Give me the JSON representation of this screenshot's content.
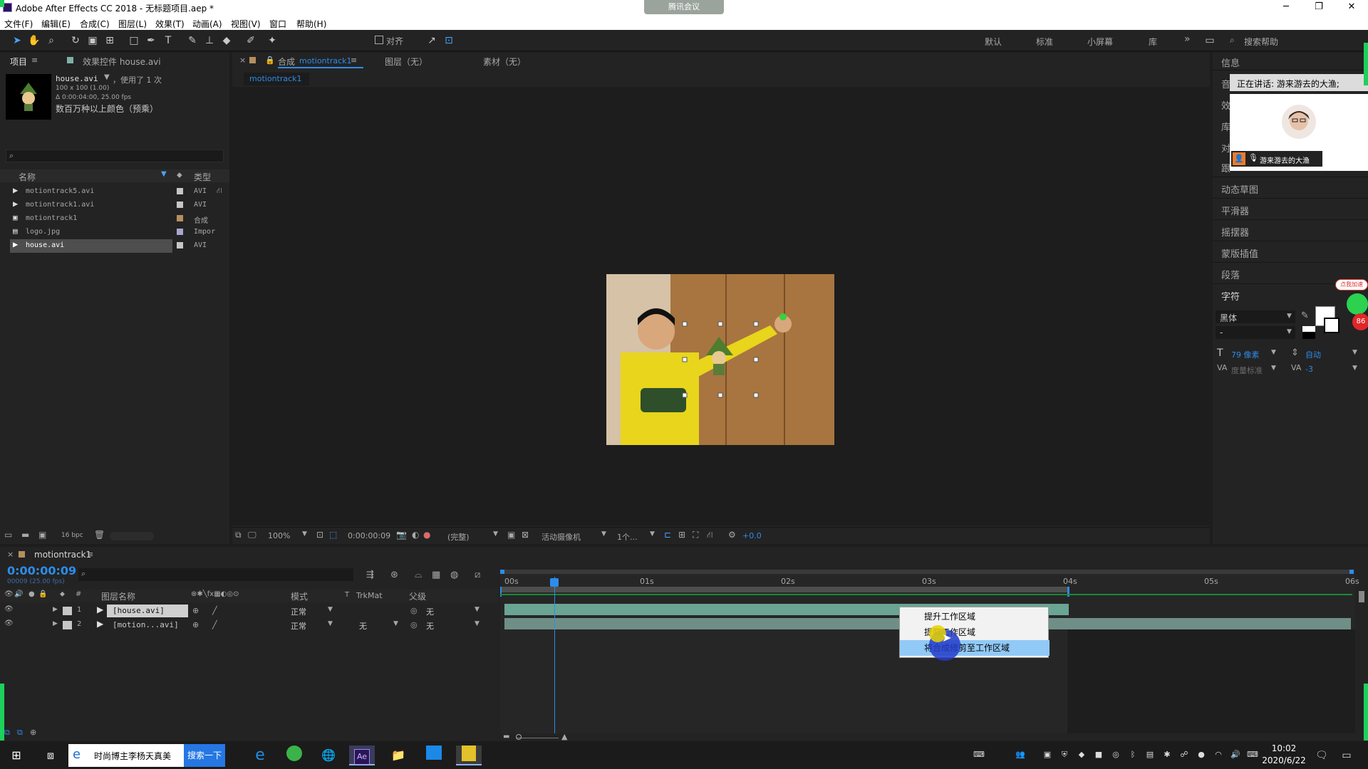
{
  "window": {
    "title": "Adobe After Effects CC 2018 - 无标题项目.aep *"
  },
  "meeting_badge": "腾讯会议",
  "menu": [
    "文件(F)",
    "编辑(E)",
    "合成(C)",
    "图层(L)",
    "效果(T)",
    "动画(A)",
    "视图(V)",
    "窗口",
    "帮助(H)"
  ],
  "toolbar": {
    "align_label": "对齐",
    "workspaces": [
      "默认",
      "标准",
      "小屏幕",
      "库"
    ],
    "search_help": "搜索帮助"
  },
  "project_panel": {
    "tab_project": "项目",
    "tab_effects": "效果控件 house.avi",
    "asset_name": "house.avi",
    "asset_used": "，使用了 1 次",
    "asset_dims": "100 x 100 (1.00)",
    "asset_duration": "Δ 0:00:04:00, 25.00 fps",
    "asset_color": "数百万种以上颜色（预乘）",
    "col_name": "名称",
    "col_type": "类型",
    "items": [
      {
        "name": "motiontrack5.avi",
        "type": "AVI",
        "color": "#c6c6c6"
      },
      {
        "name": "motiontrack1.avi",
        "type": "AVI",
        "color": "#c6c6c6"
      },
      {
        "name": "motiontrack1",
        "type": "合成",
        "color": "#b48f5f"
      },
      {
        "name": "logo.jpg",
        "type": "Impor",
        "color": "#a8a6ca"
      },
      {
        "name": "house.avi",
        "type": "AVI",
        "color": "#c6c6c6"
      }
    ],
    "bpc": "16 bpc"
  },
  "comp_panel": {
    "tab_comp_prefix": "合成",
    "tab_comp_name": "motiontrack1",
    "tab_layer": "图层（无）",
    "tab_footage": "素材（无）",
    "breadcrumb": "motiontrack1",
    "zoom": "100%",
    "timecode": "0:00:00:09",
    "quality": "(完整)",
    "camera": "活动摄像机",
    "views": "1个...",
    "exposure": "+0.0"
  },
  "right_panel": {
    "items": [
      "信息",
      "音",
      "效",
      "库",
      "对",
      "跟",
      "动态草图",
      "平滑器",
      "摇摆器",
      "蒙版插值",
      "段落",
      "字符"
    ],
    "speaking": "正在讲话: 游来游去的大渔;",
    "participant": "游来游去的大渔",
    "font": "黑体",
    "font_style": "-",
    "font_size": "79 像素",
    "leading": "自动",
    "kerning": "度量标准",
    "tracking": "-3",
    "badge_text": "点我加速",
    "badge_num": "86"
  },
  "timeline": {
    "comp_tab": "motiontrack1",
    "timecode": "0:00:00:09",
    "frame_info": "00009 (25.00 fps)",
    "col_layer_name": "图层名称",
    "col_mode": "模式",
    "col_t": "T",
    "col_trkmat": "TrkMat",
    "col_parent": "父级",
    "layers": [
      {
        "num": "1",
        "name": "[house.avi]",
        "mode": "正常",
        "trkmat": "",
        "parent": "无"
      },
      {
        "num": "2",
        "name": "[motion...avi]",
        "mode": "正常",
        "trkmat": "无",
        "parent": "无"
      }
    ],
    "ticks": [
      "00s",
      "01s",
      "02s",
      "03s",
      "04s",
      "05s",
      "06s"
    ],
    "context_menu": [
      "提升工作区域",
      "提取工作区域",
      "将合成修剪至工作区域"
    ]
  },
  "taskbar": {
    "search_text": "时尚博主李杨天真美",
    "search_button": "搜索一下",
    "time": "10:02",
    "date": "2020/6/22"
  }
}
